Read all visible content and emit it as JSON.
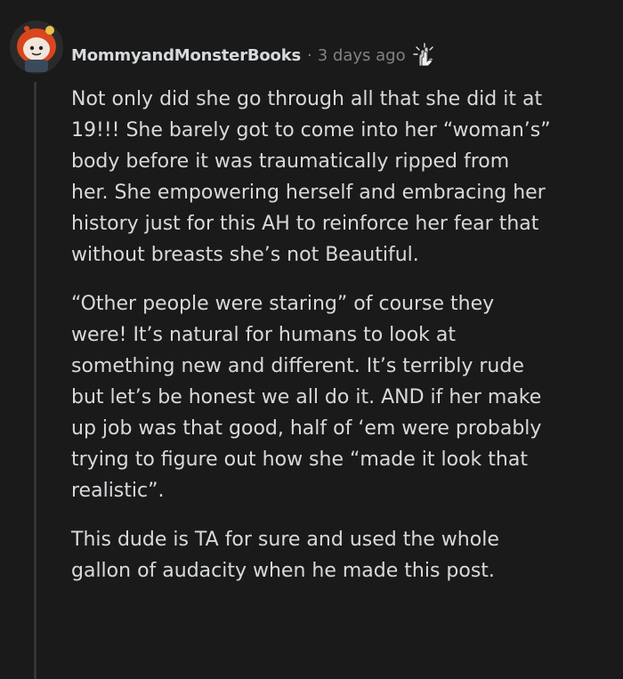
{
  "comment": {
    "author": "MommyandMonsterBooks",
    "separator": "·",
    "timestamp": "3 days ago",
    "award_icon": "clapping-hands-award-icon",
    "avatar_icon": "snoo-avatar-red-hair",
    "paragraphs": [
      "Not only did she go through all that she did it at\n19!!! She barely got to come into her “woman’s”\nbody before it was traumatically ripped from\nher. She empowering herself and embracing her\nhistory just for this AH to reinforce her fear that\nwithout breasts she’s not Beautiful.",
      "“Other people were staring” of course they\nwere! It’s natural for humans to look at\nsomething new and different. It’s terribly rude\nbut let’s be honest we all do it. AND if her make\nup job was that good, half of ‘em were probably\ntrying to figure out how she “made it look that\nrealistic”.",
      "This dude is TA for sure and used the whole\ngallon of audacity when he made this post."
    ]
  },
  "colors": {
    "background": "#1a1a1b",
    "text": "#d7dadc",
    "muted": "#818384",
    "thread_line": "#343536",
    "avatar_hair": "#e0501f"
  }
}
